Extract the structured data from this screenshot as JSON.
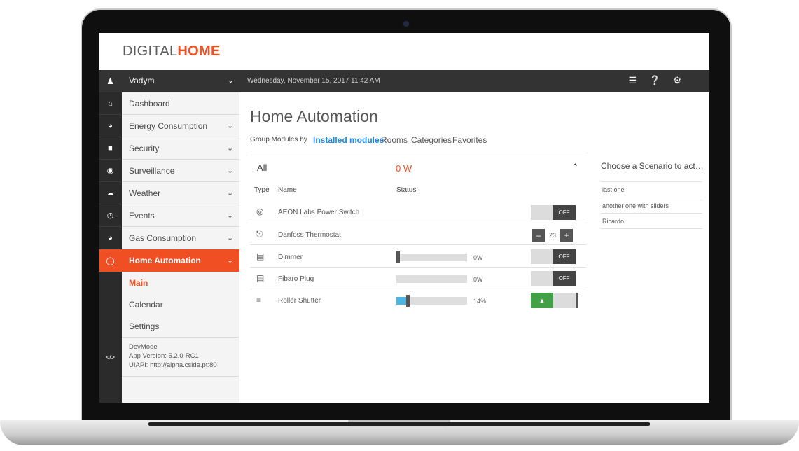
{
  "app": {
    "logo_light": "DIGITAL",
    "logo_bold": "HOME",
    "accent": "#f04e23",
    "link_color": "#1e88e5"
  },
  "topbar": {
    "user": "Vadym",
    "datetime": "Wednesday, November 15, 2017 11:42 AM",
    "icons": [
      "list-icon",
      "help-icon",
      "settings-icon"
    ]
  },
  "sidebar": {
    "items": [
      {
        "label": "Dashboard",
        "icon": "home-icon"
      },
      {
        "label": "Energy Consumption",
        "icon": "pie-chart-icon"
      },
      {
        "label": "Security",
        "icon": "lock-icon"
      },
      {
        "label": "Surveillance",
        "icon": "camera-icon"
      },
      {
        "label": "Weather",
        "icon": "cloud-icon"
      },
      {
        "label": "Events",
        "icon": "clock-icon"
      },
      {
        "label": "Gas Consumption",
        "icon": "pie-chart-icon"
      },
      {
        "label": "Home Automation",
        "icon": "bulb-icon"
      }
    ],
    "submenu": [
      "Main",
      "Calendar",
      "Settings"
    ],
    "devmode": {
      "title": "DevMode",
      "version": "App Version: 5.2.0-RC1",
      "uiapi": "UIAPI: http://alpha.cside.pt:80"
    }
  },
  "main": {
    "title": "Home Automation",
    "group_by_label": "Group Modules by",
    "group_options": [
      "Installed modules",
      "Rooms",
      "Categories",
      "Favorites"
    ],
    "selected_group": "Installed modules",
    "filter": "All",
    "total_power": "0 W",
    "columns": [
      "Type",
      "Name",
      "Status"
    ],
    "devices": [
      {
        "name": "AEON Labs Power Switch",
        "icon": "switch-icon",
        "control": "toggle",
        "toggle_label": "OFF"
      },
      {
        "name": "Danfoss Thermostat",
        "icon": "thermostat-icon",
        "control": "stepper",
        "value": "23",
        "minus": "–",
        "plus": "+"
      },
      {
        "name": "Dimmer",
        "icon": "plug-icon",
        "control": "toggle",
        "level": 0,
        "level_text": "0W",
        "toggle_label": "OFF"
      },
      {
        "name": "Fibaro Plug",
        "icon": "plug-icon",
        "control": "toggle",
        "level_text": "0W",
        "toggle_label": "OFF"
      },
      {
        "name": "Roller Shutter",
        "icon": "shutter-icon",
        "control": "shutter",
        "level": 0.14,
        "level_text": "14%",
        "up_label": "▲"
      }
    ]
  },
  "scenarios": {
    "title": "Choose a Scenario to act…",
    "items": [
      "last one",
      "another one with sliders",
      "Ricardo"
    ]
  }
}
